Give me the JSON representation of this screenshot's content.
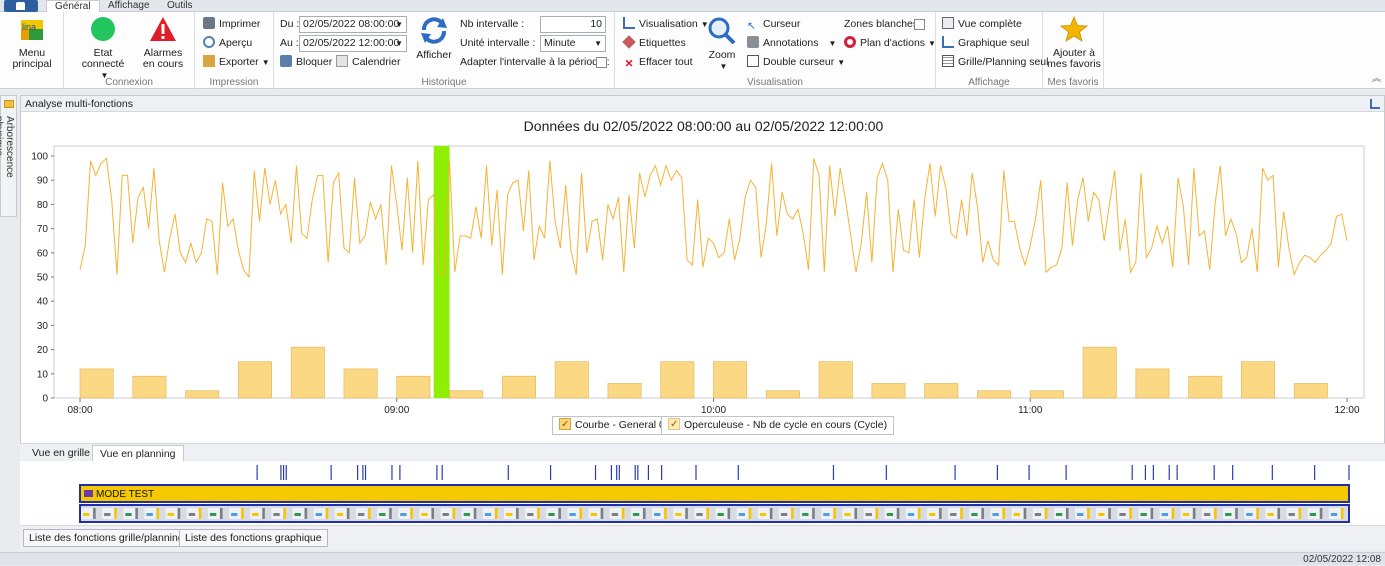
{
  "ribbon": {
    "tabs": [
      {
        "label": "Général",
        "active": true
      },
      {
        "label": "Affichage",
        "active": false
      },
      {
        "label": "Outils",
        "active": false
      }
    ],
    "groups": {
      "menu": {
        "label": "Menu principal"
      },
      "connexion": {
        "label": "Connexion",
        "etat": "Etat connecté",
        "alarmes": "Alarmes\nen cours"
      },
      "impression": {
        "label": "Impression",
        "imprimer": "Imprimer",
        "apercu": "Aperçu",
        "exporter": "Exporter"
      },
      "historique": {
        "label": "Historique",
        "du_label": "Du :",
        "du_value": "02/05/2022 08:00:00",
        "au_label": "Au :",
        "au_value": "02/05/2022 12:00:00",
        "bloquer": "Bloquer",
        "calendrier": "Calendrier",
        "afficher": "Afficher",
        "nb_intervalle_label": "Nb intervalle :",
        "nb_intervalle_value": "10",
        "unite_label": "Unité intervalle :",
        "unite_value": "Minute",
        "adapter_label": "Adapter l'intervalle à la période :"
      },
      "visualisation": {
        "label": "Visualisation",
        "visualisation": "Visualisation",
        "etiquettes": "Etiquettes",
        "effacer": "Effacer tout",
        "zoom": "Zoom",
        "curseur": "Curseur",
        "annotations": "Annotations",
        "double_curseur": "Double curseur",
        "zones_blanches": "Zones blanches",
        "plan_actions": "Plan d'actions"
      },
      "affichage": {
        "label": "Affichage",
        "vue_complete": "Vue complète",
        "graphique_seul": "Graphique seul",
        "grille_seul": "Grille/Planning seul"
      },
      "favoris": {
        "label": "Mes favoris",
        "ajouter": "Ajouter à\nmes favoris"
      }
    },
    "colors": {
      "connected": "#22c55e",
      "alarm": "#e11d2a",
      "star": "#f5b400"
    }
  },
  "leftrail": {
    "label": "Arborescence physique"
  },
  "panel": {
    "title": "Analyse multi-fonctions"
  },
  "chart_data": {
    "type": "bar+line",
    "title": "Données du 02/05/2022 08:00:00 au 02/05/2022 12:00:00",
    "xlabel": "",
    "ylabel": "",
    "ylim": [
      0,
      100
    ],
    "yticks": [
      0,
      10,
      20,
      30,
      40,
      50,
      60,
      70,
      80,
      90,
      100
    ],
    "xlim": [
      0,
      240
    ],
    "xticks": [
      {
        "v": 0,
        "label": "08:00"
      },
      {
        "v": 60,
        "label": "09:00"
      },
      {
        "v": 120,
        "label": "10:00"
      },
      {
        "v": 180,
        "label": "11:00"
      },
      {
        "v": 240,
        "label": "12:00"
      }
    ],
    "highlight_window": [
      67,
      70
    ],
    "highlight_color": "#8ef000",
    "bar_width": 6.3,
    "bar_color": "#fbd67a",
    "line_color": "#f5b335",
    "bars": {
      "name": "Operculeuse - Nb de cycle en cours (Cycle)",
      "x": [
        0,
        10,
        20,
        30,
        40,
        50,
        60,
        70,
        80,
        90,
        100,
        110,
        120,
        130,
        140,
        150,
        160,
        170,
        180,
        190,
        200,
        210,
        220,
        230
      ],
      "values": [
        12,
        9,
        3,
        15,
        21,
        12,
        9,
        3,
        9,
        15,
        6,
        15,
        15,
        3,
        15,
        6,
        6,
        3,
        3,
        21,
        12,
        9,
        15,
        6
      ]
    },
    "line": {
      "name": "Courbe - General 02",
      "x_start": 0,
      "x_step": 1,
      "values": [
        53,
        63,
        98,
        92,
        97,
        99,
        82,
        51,
        92,
        92,
        64,
        83,
        87,
        70,
        95,
        65,
        52,
        66,
        76,
        60,
        56,
        64,
        56,
        60,
        74,
        73,
        51,
        89,
        71,
        74,
        61,
        53,
        50,
        94,
        73,
        95,
        80,
        90,
        76,
        80,
        64,
        96,
        68,
        66,
        82,
        92,
        92,
        56,
        89,
        93,
        62,
        60,
        91,
        64,
        67,
        81,
        74,
        80,
        55,
        96,
        80,
        61,
        91,
        60,
        98,
        55,
        82,
        84,
        52,
        51,
        98,
        52,
        67,
        67,
        66,
        79,
        66,
        96,
        63,
        86,
        51,
        84,
        89,
        90,
        69,
        94,
        57,
        71,
        66,
        98,
        73,
        62,
        88,
        61,
        51,
        93,
        60,
        73,
        74,
        57,
        80,
        74,
        83,
        52,
        84,
        62,
        93,
        83,
        92,
        96,
        88,
        96,
        90,
        94,
        91,
        57,
        55,
        82,
        54,
        66,
        64,
        58,
        60,
        74,
        57,
        66,
        83,
        90,
        87,
        58,
        72,
        97,
        67,
        85,
        76,
        74,
        78,
        68,
        53,
        99,
        92,
        52,
        96,
        75,
        95,
        82,
        67,
        52,
        64,
        85,
        56,
        91,
        97,
        90,
        52,
        78,
        61,
        60,
        82,
        58,
        82,
        97,
        75,
        96,
        87,
        68,
        66,
        82,
        67,
        93,
        79,
        56,
        65,
        57,
        55,
        94,
        73,
        73,
        62,
        55,
        63,
        74,
        90,
        52,
        54,
        55,
        62,
        89,
        63,
        82,
        91,
        73,
        85,
        82,
        65,
        80,
        94,
        61,
        74,
        52,
        56,
        93,
        58,
        62,
        71,
        64,
        71,
        54,
        91,
        79,
        55,
        95,
        67,
        69,
        53,
        80,
        96,
        67,
        74,
        68,
        56,
        58,
        70,
        52,
        95,
        90,
        92,
        54,
        77,
        62,
        51,
        56,
        59,
        58,
        56,
        59,
        61,
        64,
        75,
        76,
        65
      ]
    },
    "legend": [
      {
        "label": "Courbe - General 02"
      },
      {
        "label": "Operculeuse - Nb de cycle en cours (Cycle)"
      }
    ]
  },
  "subtabs": [
    {
      "label": "Vue en grille",
      "active": false
    },
    {
      "label": "Vue en planning",
      "active": true
    }
  ],
  "planning": {
    "mode_label": "MODE TEST",
    "mode_color": "#f5c800",
    "marker_color": "#2a3bb8",
    "markers_x": [
      67,
      76,
      77,
      78,
      95,
      105,
      107,
      108,
      118,
      121,
      135,
      137,
      162,
      178,
      195,
      201,
      203,
      204,
      210,
      211,
      215,
      220,
      233,
      249,
      285,
      305,
      331,
      347,
      359,
      373,
      398,
      403,
      406,
      412,
      415,
      429,
      436,
      451,
      467,
      480
    ]
  },
  "bottom_buttons": [
    "Liste des fonctions grille/planning",
    "Liste des fonctions graphique"
  ],
  "status": {
    "datetime": "02/05/2022 12:08"
  }
}
